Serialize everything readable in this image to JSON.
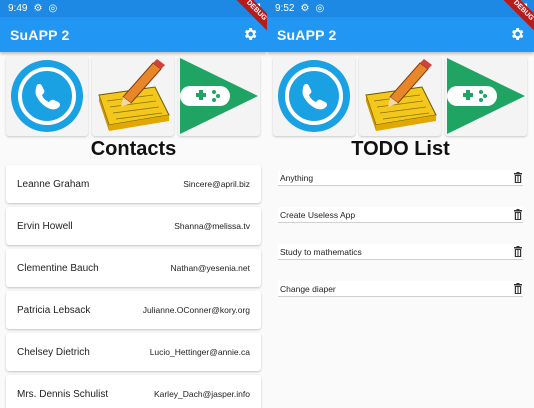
{
  "left": {
    "status_time": "9:49",
    "debug_label": "DEBUG",
    "app_title": "SuAPP 2",
    "section_title": "Contacts",
    "contacts": [
      {
        "name": "Leanne Graham",
        "email": "Sincere@april.biz"
      },
      {
        "name": "Ervin Howell",
        "email": "Shanna@melissa.tv"
      },
      {
        "name": "Clementine Bauch",
        "email": "Nathan@yesenia.net"
      },
      {
        "name": "Patricia Lebsack",
        "email": "Julianne.OConner@kory.org"
      },
      {
        "name": "Chelsey Dietrich",
        "email": "Lucio_Hettinger@annie.ca"
      },
      {
        "name": "Mrs. Dennis Schulist",
        "email": "Karley_Dach@jasper.info"
      }
    ]
  },
  "right": {
    "status_time": "9:52",
    "debug_label": "DEBUG",
    "app_title": "SuAPP 2",
    "section_title": "TODO List",
    "todos": [
      "Anything",
      "Create Useless App",
      "Study to mathematics",
      "Change diaper"
    ]
  },
  "icons": [
    "phone-icon",
    "notepad-icon",
    "game-controller-icon"
  ],
  "colors": {
    "appbar": "#2196f3",
    "statusbar": "#1e88e5",
    "phone_blue": "#1aa1e3",
    "game_green": "#1fa463",
    "debug_red": "#b71c1c"
  }
}
